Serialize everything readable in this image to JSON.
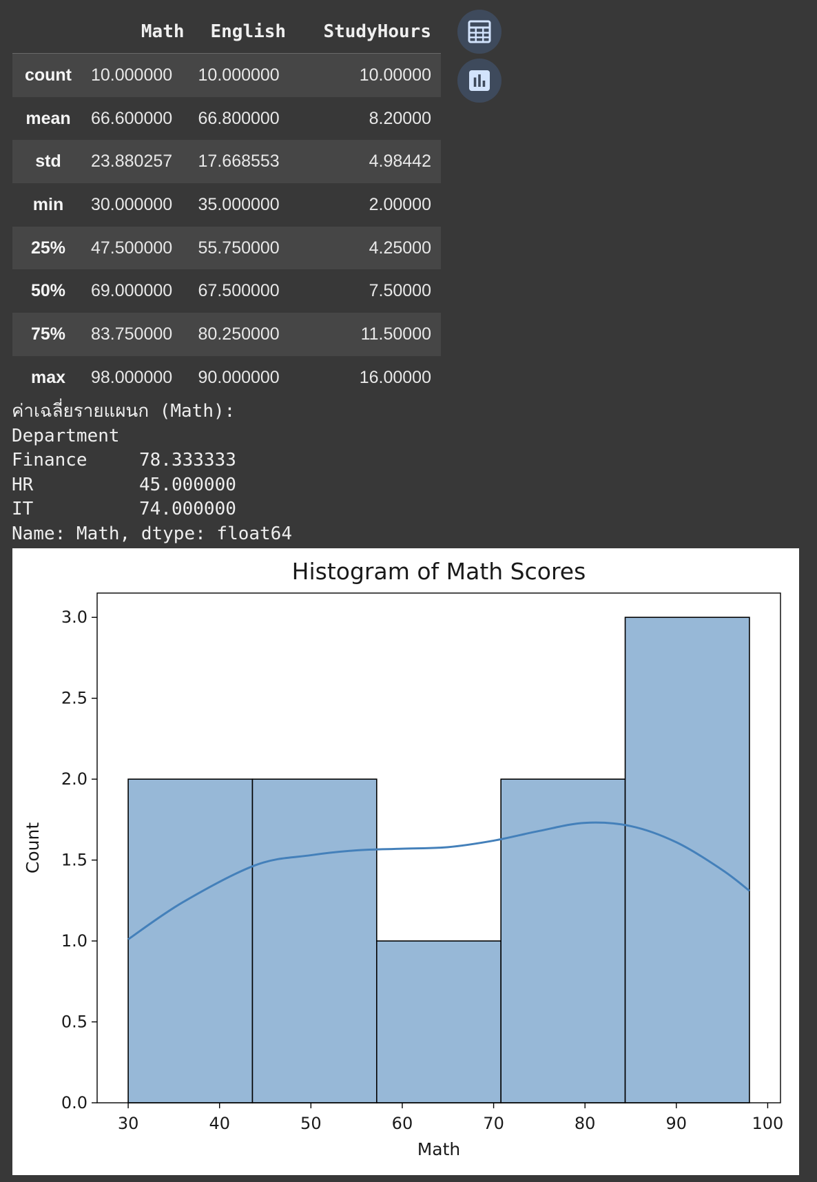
{
  "table": {
    "columns": [
      "Math",
      "English",
      "StudyHours"
    ],
    "rows": [
      {
        "label": "count",
        "values": [
          "10.000000",
          "10.000000",
          "10.00000"
        ]
      },
      {
        "label": "mean",
        "values": [
          "66.600000",
          "66.800000",
          "8.20000"
        ]
      },
      {
        "label": "std",
        "values": [
          "23.880257",
          "17.668553",
          "4.98442"
        ]
      },
      {
        "label": "min",
        "values": [
          "30.000000",
          "35.000000",
          "2.00000"
        ]
      },
      {
        "label": "25%",
        "values": [
          "47.500000",
          "55.750000",
          "4.25000"
        ]
      },
      {
        "label": "50%",
        "values": [
          "69.000000",
          "67.500000",
          "7.50000"
        ]
      },
      {
        "label": "75%",
        "values": [
          "83.750000",
          "80.250000",
          "11.50000"
        ]
      },
      {
        "label": "max",
        "values": [
          "98.000000",
          "90.000000",
          "16.00000"
        ]
      }
    ]
  },
  "side_buttons": {
    "table_icon": "table-icon",
    "chart_icon": "bar-chart-icon",
    "button_color": "#3e4a5c",
    "icon_color": "#d2e3fc"
  },
  "stdout": {
    "heading": "ค่าเฉลี่ยรายแผนก (Math):",
    "index_name": "Department",
    "rows": [
      {
        "name": "Finance",
        "value": "78.333333"
      },
      {
        "name": "HR",
        "value": "45.000000"
      },
      {
        "name": "IT",
        "value": "74.000000"
      }
    ],
    "footer": "Name: Math, dtype: float64"
  },
  "chart_data": {
    "type": "bar",
    "title": "Histogram of Math Scores",
    "xlabel": "Math",
    "ylabel": "Count",
    "xlim": [
      26.6,
      101.4
    ],
    "ylim": [
      0,
      3.15
    ],
    "xticks": [
      "30",
      "40",
      "50",
      "60",
      "70",
      "80",
      "90",
      "100"
    ],
    "yticks": [
      "0.0",
      "0.5",
      "1.0",
      "1.5",
      "2.0",
      "2.5",
      "3.0"
    ],
    "bin_edges": [
      30,
      43.6,
      57.2,
      70.8,
      84.4,
      98
    ],
    "values": [
      2,
      2,
      1,
      2,
      3
    ],
    "kde": {
      "x": [
        30,
        36,
        44,
        50,
        55,
        60,
        65,
        70,
        75,
        80,
        85,
        90,
        95,
        98
      ],
      "y": [
        1.01,
        1.24,
        1.47,
        1.53,
        1.56,
        1.57,
        1.58,
        1.62,
        1.68,
        1.73,
        1.71,
        1.61,
        1.44,
        1.31
      ]
    },
    "bar_color": "#97b8d7",
    "line_color": "#4480ba",
    "grid": false,
    "legend": "none"
  }
}
